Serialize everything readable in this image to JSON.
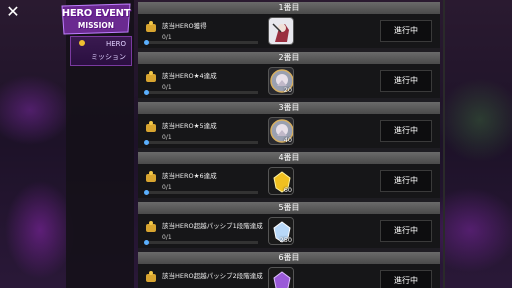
{
  "header": {
    "close_label": "✕",
    "event_logo_line1": "HERO EVENT",
    "event_logo_line2": "MISSION",
    "tab_line1": "HERO",
    "tab_line2": "ミッション"
  },
  "missions": [
    {
      "section": "1番目",
      "title": "該当HERO獲得",
      "progress": "0/1",
      "progress_fraction": 0.0,
      "reward_qty": "",
      "reward_icon": "hero-portrait-icon",
      "status": "進行中"
    },
    {
      "section": "2番目",
      "title": "該当HERO★4達成",
      "progress": "0/1",
      "progress_fraction": 0.0,
      "reward_qty": "20",
      "reward_icon": "silver-medal-icon",
      "status": "進行中"
    },
    {
      "section": "3番目",
      "title": "該当HERO★5達成",
      "progress": "0/1",
      "progress_fraction": 0.0,
      "reward_qty": "40",
      "reward_icon": "silver-medal-icon",
      "status": "進行中"
    },
    {
      "section": "4番目",
      "title": "該当HERO★6達成",
      "progress": "0/1",
      "progress_fraction": 0.0,
      "reward_qty": "60",
      "reward_icon": "gold-crystal-icon",
      "status": "進行中"
    },
    {
      "section": "5番目",
      "title": "該当HERO超越パッシブ1段階達成",
      "progress": "0/1",
      "progress_fraction": 0.0,
      "reward_qty": "250",
      "reward_icon": "blue-crystal-icon",
      "status": "進行中"
    },
    {
      "section": "6番目",
      "title": "該当HERO超越パッシブ2段階達成",
      "progress": "",
      "progress_fraction": 0.0,
      "reward_qty": "",
      "reward_icon": "purple-crystal-icon",
      "status": "進行中"
    }
  ],
  "colors": {
    "accent_blue": "#4aa0e0",
    "event_purple": "#7a3aa0",
    "gold": "#f0c030"
  }
}
